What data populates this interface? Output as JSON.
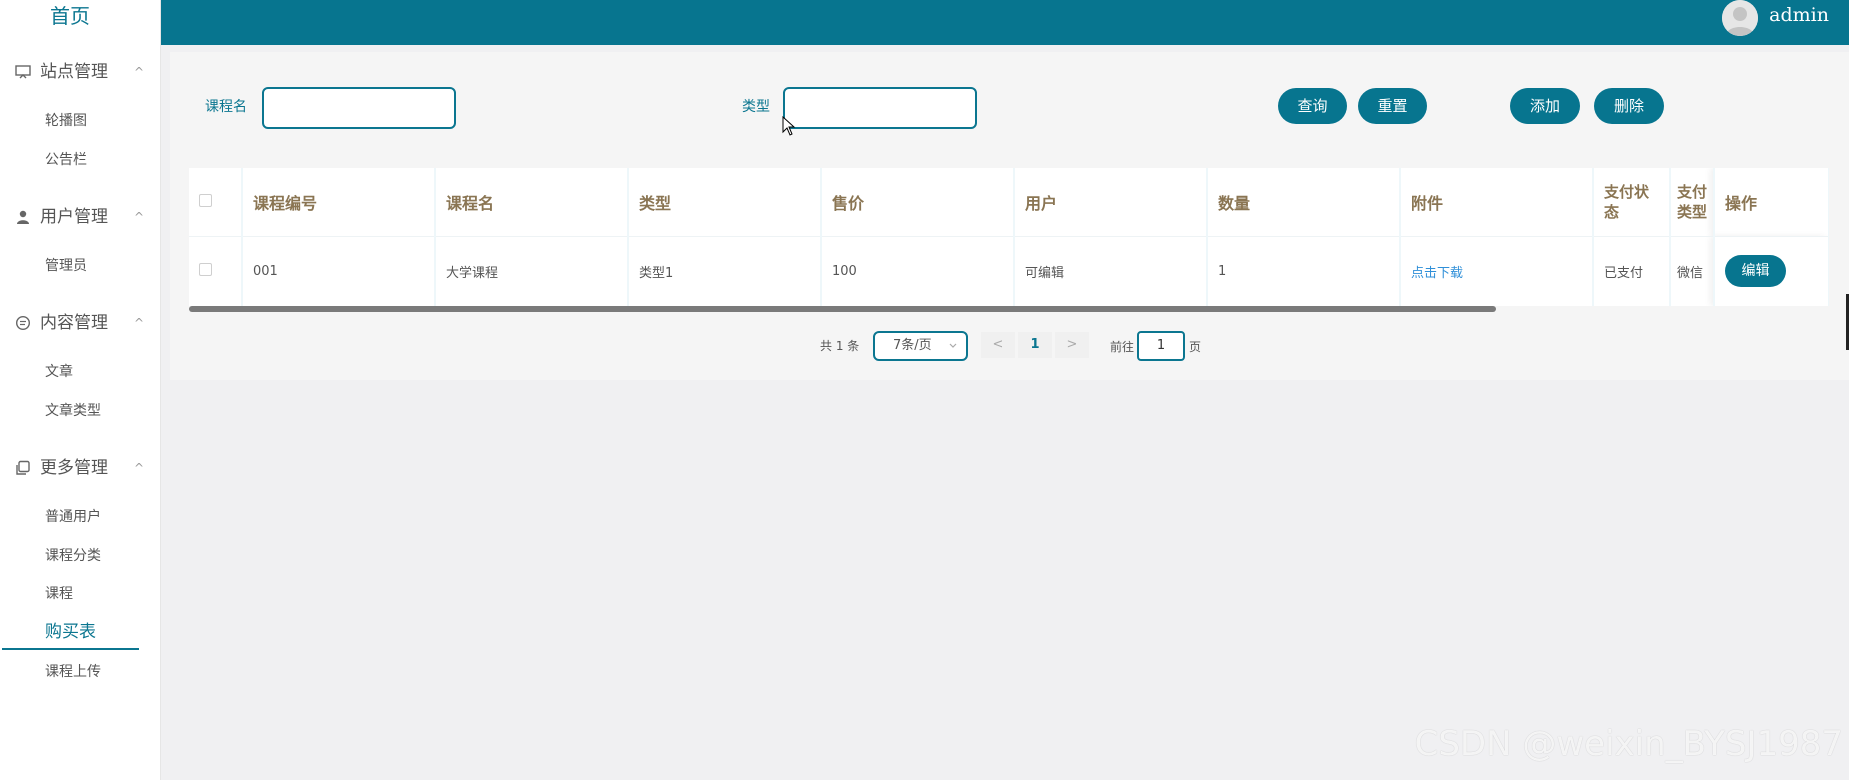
{
  "header": {
    "username": "admin"
  },
  "sidebar": {
    "home": "首页",
    "groups": [
      {
        "title": "站点管理",
        "icon": "monitor-icon",
        "items": [
          {
            "label": "轮播图"
          },
          {
            "label": "公告栏"
          }
        ]
      },
      {
        "title": "用户管理",
        "icon": "user-icon",
        "items": [
          {
            "label": "管理员"
          }
        ]
      },
      {
        "title": "内容管理",
        "icon": "message-icon",
        "items": [
          {
            "label": "文章"
          },
          {
            "label": "文章类型"
          }
        ]
      },
      {
        "title": "更多管理",
        "icon": "copy-icon",
        "items": [
          {
            "label": "普通用户"
          },
          {
            "label": "课程分类"
          },
          {
            "label": "课程"
          },
          {
            "label": "购买表"
          },
          {
            "label": "课程上传"
          }
        ]
      }
    ],
    "active_item": "购买表",
    "chevron": "^"
  },
  "search": {
    "course_name_label": "课程名",
    "course_name_value": "",
    "type_label": "类型",
    "type_value": ""
  },
  "buttons": {
    "query": "查询",
    "reset": "重置",
    "add": "添加",
    "delete": "删除"
  },
  "table": {
    "columns": [
      "课程编号",
      "课程名",
      "类型",
      "售价",
      "用户",
      "数量",
      "附件",
      "支付状态",
      "支付类型",
      "操作"
    ],
    "rows": [
      {
        "course_id": "001",
        "course_name": "大学课程",
        "type": "类型1",
        "price": "100",
        "user": "可编辑",
        "quantity": "1",
        "attachment": "点击下载",
        "pay_status": "已支付",
        "pay_type": "微信",
        "action": "编辑"
      }
    ]
  },
  "pagination": {
    "total": "共 1 条",
    "page_size": "7条/页",
    "current_page": "1",
    "prev": "<",
    "next": ">",
    "goto_label": "前往",
    "goto_value": "1",
    "page_suffix": "页"
  },
  "watermark": "CSDN @weixin_BYSJ1987",
  "colors": {
    "primary": "#07758f",
    "header_text": "#8a7553",
    "link": "#2f8fd8"
  }
}
